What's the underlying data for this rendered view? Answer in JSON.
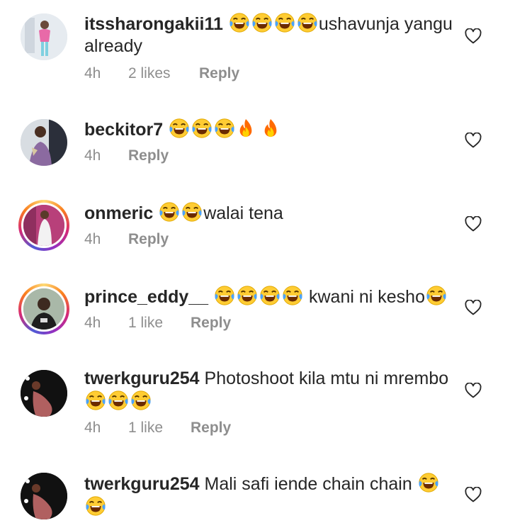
{
  "comments": [
    {
      "username": "itssharongakii11",
      "text_before": "",
      "text_after": "ushavunja yangu already",
      "time": "4h",
      "likes": "2 likes",
      "reply": "Reply"
    },
    {
      "username": "beckitor7",
      "time": "4h",
      "reply": "Reply"
    },
    {
      "username": "onmeric",
      "text_after": "walai tena",
      "time": "4h",
      "reply": "Reply"
    },
    {
      "username": "prince_eddy__",
      "text_after": " kwani ni kesho",
      "time": "4h",
      "likes": "1 like",
      "reply": "Reply"
    },
    {
      "username": "twerkguru254",
      "text_before": "Photoshoot kila mtu ni mrembo",
      "time": "4h",
      "likes": "1 like",
      "reply": "Reply"
    },
    {
      "username": "twerkguru254",
      "text_before": "Mali safi iende chain chain ",
      "time": "",
      "reply": ""
    }
  ],
  "icons": {
    "like": "heart-outline-icon",
    "laugh": "face-with-tears-of-joy-emoji",
    "fire": "fire-emoji"
  },
  "colors": {
    "text": "#262626",
    "meta": "#8e8e8e",
    "story_ring_start": "#feda75",
    "story_ring_end": "#d62976"
  }
}
